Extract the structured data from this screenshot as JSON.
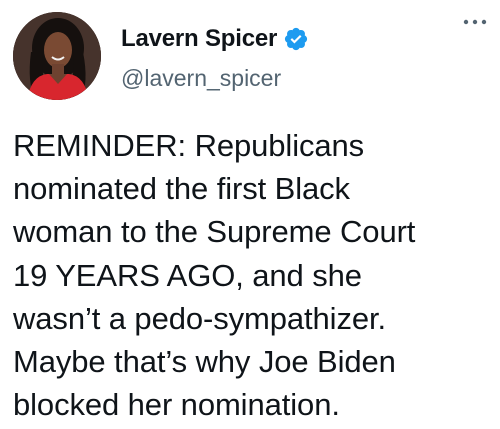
{
  "author": {
    "display_name": "Lavern Spicer",
    "handle": "@lavern_spicer",
    "verified": true,
    "avatar_icon": "profile-photo"
  },
  "tweet": {
    "lines": [
      "REMINDER: Republicans",
      "nominated the first Black",
      "woman to the Supreme Court",
      "19 YEARS AGO, and she",
      "wasn’t a pedo-sympathizer.",
      "Maybe that’s why Joe Biden",
      "blocked her nomination."
    ]
  },
  "icons": {
    "verified_badge": "verified-badge-icon",
    "more": "more-options-icon"
  },
  "colors": {
    "text": "#0f1419",
    "secondary_text": "#536471",
    "verified_blue": "#1d9bf0",
    "avatar_red": "#d8262e"
  }
}
